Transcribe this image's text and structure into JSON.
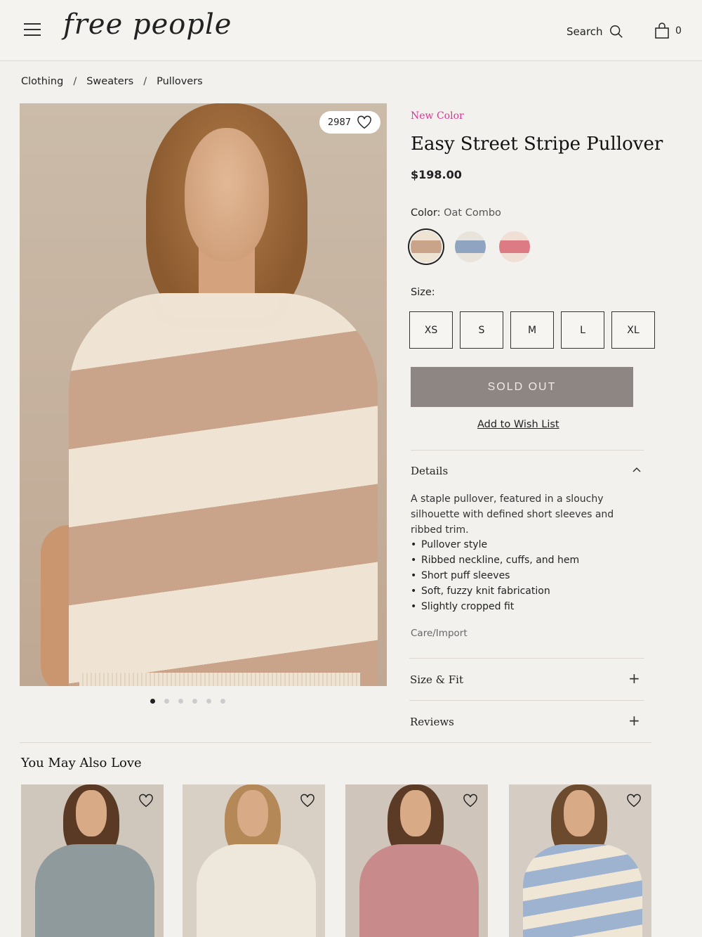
{
  "header": {
    "logo": "free people",
    "search_label": "Search",
    "cart_count": "0"
  },
  "breadcrumb": [
    "Clothing",
    "Sweaters",
    "Pullovers"
  ],
  "gallery": {
    "like_count": "2987",
    "slide_count": 6,
    "active_slide": 1
  },
  "product": {
    "badge": "New Color",
    "title": "Easy Street Stripe Pullover",
    "price": "$198.00",
    "color_label": "Color:",
    "color_value": "Oat Combo",
    "swatches": [
      {
        "name": "Oat Combo",
        "colors": [
          "#c9a48b",
          "#efe4d3"
        ],
        "selected": true
      },
      {
        "name": "Blue Combo",
        "colors": [
          "#8ea4c0",
          "#e8e4dc"
        ],
        "selected": false
      },
      {
        "name": "Pink Combo",
        "colors": [
          "#dd7b84",
          "#f0dfd4"
        ],
        "selected": false
      }
    ],
    "size_label": "Size:",
    "sizes": [
      "XS",
      "S",
      "M",
      "L",
      "XL"
    ],
    "sold_out_label": "SOLD OUT",
    "wish_list_label": "Add to Wish List"
  },
  "details": {
    "heading": "Details",
    "description": "A staple pullover, featured in a slouchy silhouette with defined short sleeves and ribbed trim.",
    "bullets": [
      "Pullover style",
      "Ribbed neckline, cuffs, and hem",
      "Short puff sleeves",
      "Soft, fuzzy knit fabrication",
      "Slightly cropped fit"
    ],
    "care_label": "Care/Import"
  },
  "accordions": {
    "size_fit": "Size & Fit",
    "reviews": "Reviews"
  },
  "recommendations": {
    "title": "You May Also Love",
    "items": [
      {
        "sweater_color": "#8f9a9c",
        "bg": "#cfc6bc",
        "hair": "#5a3a25"
      },
      {
        "sweater_color": "#eee8dc",
        "bg": "#d8d0c5",
        "hair": "#b58858"
      },
      {
        "sweater_color": "#c98a8c",
        "bg": "#cfc5bb",
        "hair": "#5b3b25"
      },
      {
        "sweater_color": "#9db3cf",
        "bg": "#d5cdc3",
        "hair": "#6c4a2e"
      }
    ]
  }
}
